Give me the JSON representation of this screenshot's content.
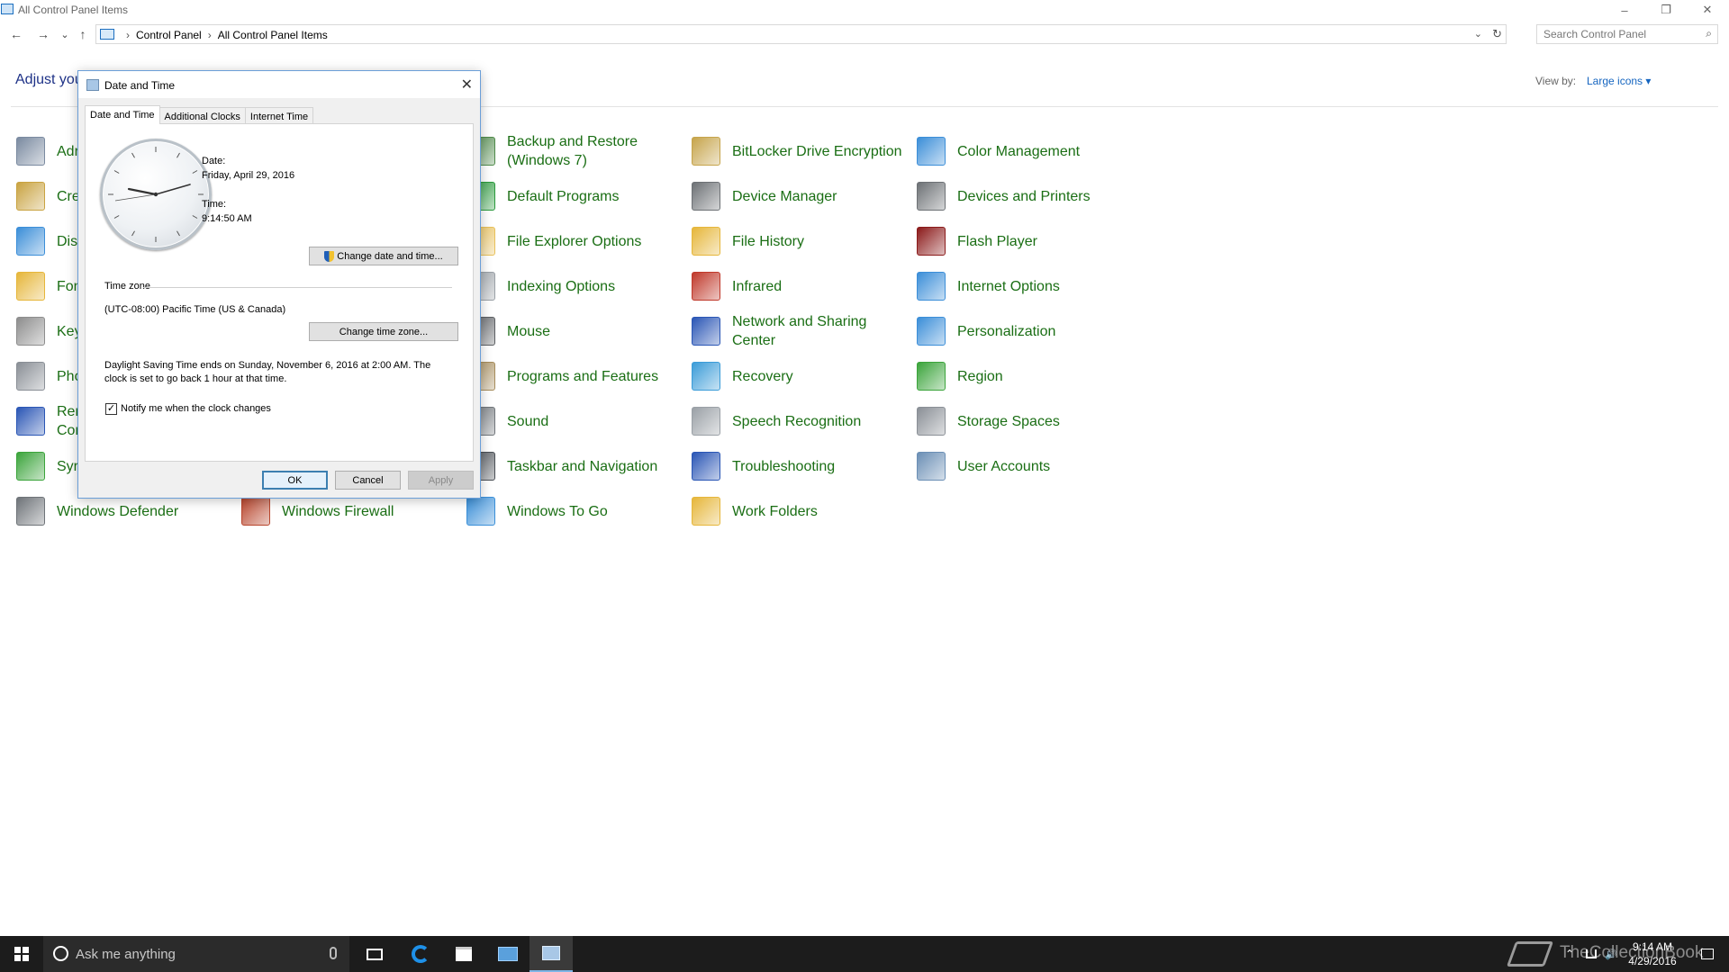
{
  "window": {
    "title": "All Control Panel Items",
    "minimize_glyph": "–",
    "restore_glyph": "❐",
    "close_glyph": "✕"
  },
  "nav": {
    "back": "←",
    "forward": "→",
    "recent": "⌄",
    "up": "↑",
    "breadcrumbs": [
      "Control Panel",
      "All Control Panel Items"
    ],
    "separator": "›",
    "dropdown": "⌄",
    "refresh": "↻",
    "search_placeholder": "Search Control Panel",
    "search_icon": "⌕"
  },
  "header": {
    "adjust_text": "Adjust you",
    "view_by_label": "View by:",
    "view_by_value": "Large icons ▾"
  },
  "items": [
    {
      "label": "Adr",
      "icon": "administrative-tools-icon",
      "color": "#7a8aa0"
    },
    {
      "label": "Cre",
      "icon": "credential-manager-icon",
      "color": "#c9a341"
    },
    {
      "label": "Dis",
      "icon": "display-icon",
      "color": "#3b8ed8"
    },
    {
      "label": "Fon",
      "icon": "fonts-icon",
      "color": "#e6b63a"
    },
    {
      "label": "Key",
      "icon": "keyboard-icon",
      "color": "#8d8d8d"
    },
    {
      "label": "Pho",
      "icon": "phone-and-modem-icon",
      "color": "#8a8f96"
    },
    {
      "label": "Rer\nCor",
      "icon": "remoteapp-icon",
      "color": "#2a56b5"
    },
    {
      "label": "Syr",
      "icon": "sync-center-icon",
      "color": "#3ba43b"
    },
    {
      "label": "Windows Defender",
      "icon": "windows-defender-icon",
      "color": "#6e7378"
    },
    {
      "label": "Windows Firewall",
      "icon": "windows-firewall-icon",
      "color": "#b8452c"
    },
    {
      "label": "Backup and Restore\n(Windows 7)",
      "icon": "backup-restore-icon",
      "color": "#4f8a4a"
    },
    {
      "label": "Default Programs",
      "icon": "default-programs-icon",
      "color": "#2a9a3c"
    },
    {
      "label": "File Explorer Options",
      "icon": "file-explorer-options-icon",
      "color": "#e8c05a"
    },
    {
      "label": "Indexing Options",
      "icon": "indexing-options-icon",
      "color": "#9aa0a6"
    },
    {
      "label": "Mouse",
      "icon": "mouse-icon",
      "color": "#5c5f63"
    },
    {
      "label": "Programs and Features",
      "icon": "programs-features-icon",
      "color": "#a68c5b"
    },
    {
      "label": "Sound",
      "icon": "sound-icon",
      "color": "#70757a"
    },
    {
      "label": "Taskbar and Navigation",
      "icon": "taskbar-navigation-icon",
      "color": "#4a4f55"
    },
    {
      "label": "Windows To Go",
      "icon": "windows-to-go-icon",
      "color": "#3a8fd8"
    },
    {
      "label": "BitLocker Drive Encryption",
      "icon": "bitlocker-icon",
      "color": "#c6a44b"
    },
    {
      "label": "Device Manager",
      "icon": "device-manager-icon",
      "color": "#6d7175"
    },
    {
      "label": "File History",
      "icon": "file-history-icon",
      "color": "#e6b63a"
    },
    {
      "label": "Infrared",
      "icon": "infrared-icon",
      "color": "#c0392b"
    },
    {
      "label": "Network and Sharing\nCenter",
      "icon": "network-sharing-icon",
      "color": "#2a56b5"
    },
    {
      "label": "Recovery",
      "icon": "recovery-icon",
      "color": "#3b9cd8"
    },
    {
      "label": "Speech Recognition",
      "icon": "speech-recognition-icon",
      "color": "#9aa0a6"
    },
    {
      "label": "Troubleshooting",
      "icon": "troubleshooting-icon",
      "color": "#2a56b5"
    },
    {
      "label": "Work Folders",
      "icon": "work-folders-icon",
      "color": "#e6b63a"
    },
    {
      "label": "Color Management",
      "icon": "color-management-icon",
      "color": "#3b8ed8"
    },
    {
      "label": "Devices and Printers",
      "icon": "devices-printers-icon",
      "color": "#6d7175"
    },
    {
      "label": "Flash Player",
      "icon": "flash-player-icon",
      "color": "#8b1a1a"
    },
    {
      "label": "Internet Options",
      "icon": "internet-options-icon",
      "color": "#3b8ed8"
    },
    {
      "label": "Personalization",
      "icon": "personalization-icon",
      "color": "#3b8ed8"
    },
    {
      "label": "Region",
      "icon": "region-icon",
      "color": "#3ba43b"
    },
    {
      "label": "Storage Spaces",
      "icon": "storage-spaces-icon",
      "color": "#8a8f96"
    },
    {
      "label": "User Accounts",
      "icon": "user-accounts-icon",
      "color": "#6b8fb5"
    }
  ],
  "dialog": {
    "title": "Date and Time",
    "close_glyph": "✕",
    "tabs": [
      "Date and Time",
      "Additional Clocks",
      "Internet Time"
    ],
    "date_label": "Date:",
    "date_value": "Friday, April 29, 2016",
    "time_label": "Time:",
    "time_value": "9:14:50 AM",
    "change_datetime_btn": "Change date and time...",
    "timezone_heading": "Time zone",
    "timezone_value": "(UTC-08:00) Pacific Time (US & Canada)",
    "change_timezone_btn": "Change time zone...",
    "dst_line1": "Daylight Saving Time ends on Sunday, November 6, 2016 at 2:00 AM. The",
    "dst_line2": "clock is set to go back 1 hour at that time.",
    "notify_check": "✓",
    "notify_label": "Notify me when the clock changes",
    "ok_btn": "OK",
    "cancel_btn": "Cancel",
    "apply_btn": "Apply"
  },
  "taskbar": {
    "search_placeholder": "Ask me anything",
    "time": "9:14 AM",
    "date": "4/29/2016",
    "watermark": "TheCollectionBook",
    "tray_up": "⌃",
    "tray_volume": "🔊"
  }
}
